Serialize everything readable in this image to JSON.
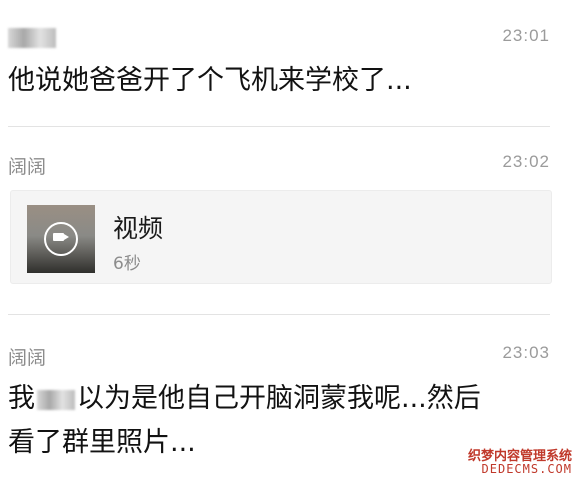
{
  "messages": [
    {
      "sender": "",
      "time": "23:01",
      "text": "他说她爸爸开了个飞机来学校了..."
    },
    {
      "sender": "阔阔",
      "time": "23:02",
      "video": {
        "title": "视频",
        "duration": "6秒",
        "icon": "video-play-icon"
      }
    },
    {
      "sender": "阔阔",
      "time": "23:03",
      "text_prefix": "我",
      "text_line1": "以为是他自己开脑洞蒙我呢...然后",
      "text_line2": "看了群里照片..."
    }
  ],
  "watermark": {
    "line1": "织梦内容管理系统",
    "line2": "DEDECMS.COM"
  },
  "colors": {
    "divider": "#e3e3e3",
    "meta_text": "#8c8c8c",
    "watermark": "#c0392b"
  }
}
